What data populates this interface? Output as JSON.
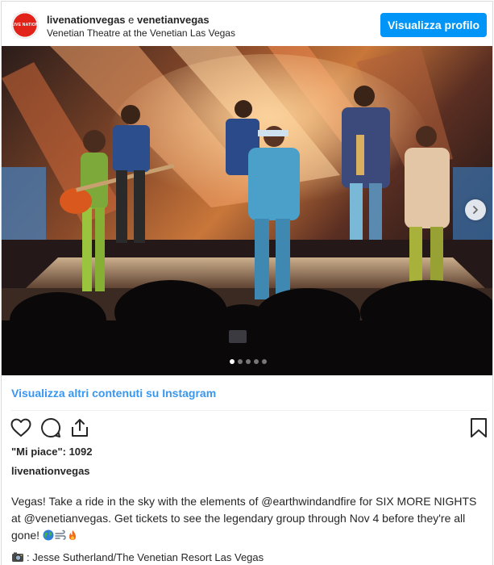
{
  "header": {
    "account_primary": "livenationvegas",
    "joiner": " e ",
    "account_secondary": "venetianvegas",
    "location": "Venetian Theatre at the Venetian Las Vegas",
    "view_profile_label": "Visualizza profilo",
    "avatar_text": "LIVE NATION"
  },
  "carousel": {
    "slide_count": 5,
    "active_index": 0
  },
  "more_link": "Visualizza altri contenuti su Instagram",
  "actions": {
    "like_icon": "heart-icon",
    "comment_icon": "comment-icon",
    "share_icon": "share-icon",
    "save_icon": "bookmark-icon"
  },
  "likes_text": "\"Mi piace\": 1092",
  "author": "livenationvegas",
  "caption": {
    "part1": "Vegas! Take a ride in the sky with the elements of ",
    "mention1": "@earthwindandfire",
    "part2": " for SIX MORE NIGHTS at ",
    "mention2": "@venetianvegas",
    "part3": ". Get tickets to see the legendary group through Nov 4 before they're all gone! ",
    "emoji_names": [
      "globe-emoji",
      "wind-emoji",
      "fire-emoji"
    ]
  },
  "credit_text": ": Jesse Sutherland/The Venetian Resort Las Vegas",
  "colors": {
    "button_blue": "#0095f6",
    "link_blue": "#3897f0",
    "text": "#262626"
  }
}
